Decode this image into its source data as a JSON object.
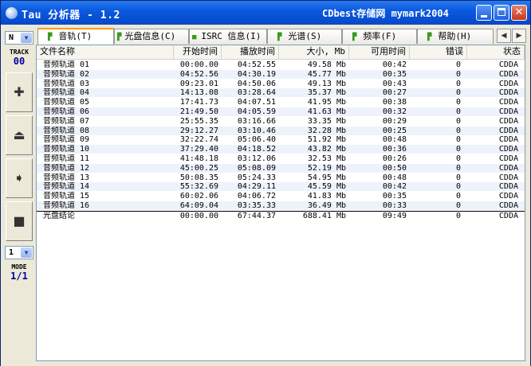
{
  "window": {
    "title": "Tau 分析器 - 1.2",
    "title_right": "CDbest存储网 mymark2004",
    "minimize_glyph": "_",
    "close_glyph": "✕"
  },
  "sidebar": {
    "drive_value": "N",
    "track_label": "TRACK",
    "track_value": "00",
    "buttons": [
      {
        "name": "add",
        "glyph": "✚"
      },
      {
        "name": "eject",
        "glyph": "⏏"
      },
      {
        "name": "play",
        "glyph": "➧"
      },
      {
        "name": "stop",
        "glyph": "■"
      }
    ],
    "mode_select_value": "1",
    "mode_label": "MODE",
    "mode_value": "1/1"
  },
  "tabs": [
    {
      "label": "音轨(T)",
      "icon": "▛",
      "active": true
    },
    {
      "label": "光盘信息(C)",
      "icon": "▛",
      "active": false
    },
    {
      "label": "ISRC 信息(I)",
      "icon": "■",
      "active": false
    },
    {
      "label": "光谱(S)",
      "icon": "▛",
      "active": false
    },
    {
      "label": "频率(F)",
      "icon": "▛",
      "active": false
    },
    {
      "label": "帮助(H)",
      "icon": "▛",
      "active": false
    }
  ],
  "tab_nav": {
    "left": "◀",
    "right": "▶"
  },
  "columns": [
    "文件名称",
    "开始时间",
    "播放时间",
    "大小, Mb",
    "可用时间",
    "错误",
    "状态"
  ],
  "rows": [
    [
      "音频轨道 01",
      "00:00.00",
      "04:52.55",
      "49.58 Mb",
      "00:42",
      "0",
      "CDDA"
    ],
    [
      "音频轨道 02",
      "04:52.56",
      "04:30.19",
      "45.77 Mb",
      "00:35",
      "0",
      "CDDA"
    ],
    [
      "音频轨道 03",
      "09:23.01",
      "04:50.06",
      "49.13 Mb",
      "00:43",
      "0",
      "CDDA"
    ],
    [
      "音频轨道 04",
      "14:13.08",
      "03:28.64",
      "35.37 Mb",
      "00:27",
      "0",
      "CDDA"
    ],
    [
      "音频轨道 05",
      "17:41.73",
      "04:07.51",
      "41.95 Mb",
      "00:38",
      "0",
      "CDDA"
    ],
    [
      "音频轨道 06",
      "21:49.50",
      "04:05.59",
      "41.63 Mb",
      "00:32",
      "0",
      "CDDA"
    ],
    [
      "音频轨道 07",
      "25:55.35",
      "03:16.66",
      "33.35 Mb",
      "00:29",
      "0",
      "CDDA"
    ],
    [
      "音频轨道 08",
      "29:12.27",
      "03:10.46",
      "32.28 Mb",
      "00:25",
      "0",
      "CDDA"
    ],
    [
      "音频轨道 09",
      "32:22.74",
      "05:06.40",
      "51.92 Mb",
      "00:48",
      "0",
      "CDDA"
    ],
    [
      "音频轨道 10",
      "37:29.40",
      "04:18.52",
      "43.82 Mb",
      "00:36",
      "0",
      "CDDA"
    ],
    [
      "音频轨道 11",
      "41:48.18",
      "03:12.06",
      "32.53 Mb",
      "00:26",
      "0",
      "CDDA"
    ],
    [
      "音频轨道 12",
      "45:00.25",
      "05:08.09",
      "52.19 Mb",
      "00:50",
      "0",
      "CDDA"
    ],
    [
      "音频轨道 13",
      "50:08.35",
      "05:24.33",
      "54.95 Mb",
      "00:48",
      "0",
      "CDDA"
    ],
    [
      "音频轨道 14",
      "55:32.69",
      "04:29.11",
      "45.59 Mb",
      "00:42",
      "0",
      "CDDA"
    ],
    [
      "音频轨道 15",
      "60:02.06",
      "04:06.72",
      "41.83 Mb",
      "00:35",
      "0",
      "CDDA"
    ],
    [
      "音频轨道 16",
      "64:09.04",
      "03:35.33",
      "36.49 Mb",
      "00:33",
      "0",
      "CDDA"
    ]
  ],
  "total_row": [
    "光盘结论",
    "00:00.00",
    "67:44.37",
    "688.41 Mb",
    "09:49",
    "0",
    "CDDA"
  ]
}
